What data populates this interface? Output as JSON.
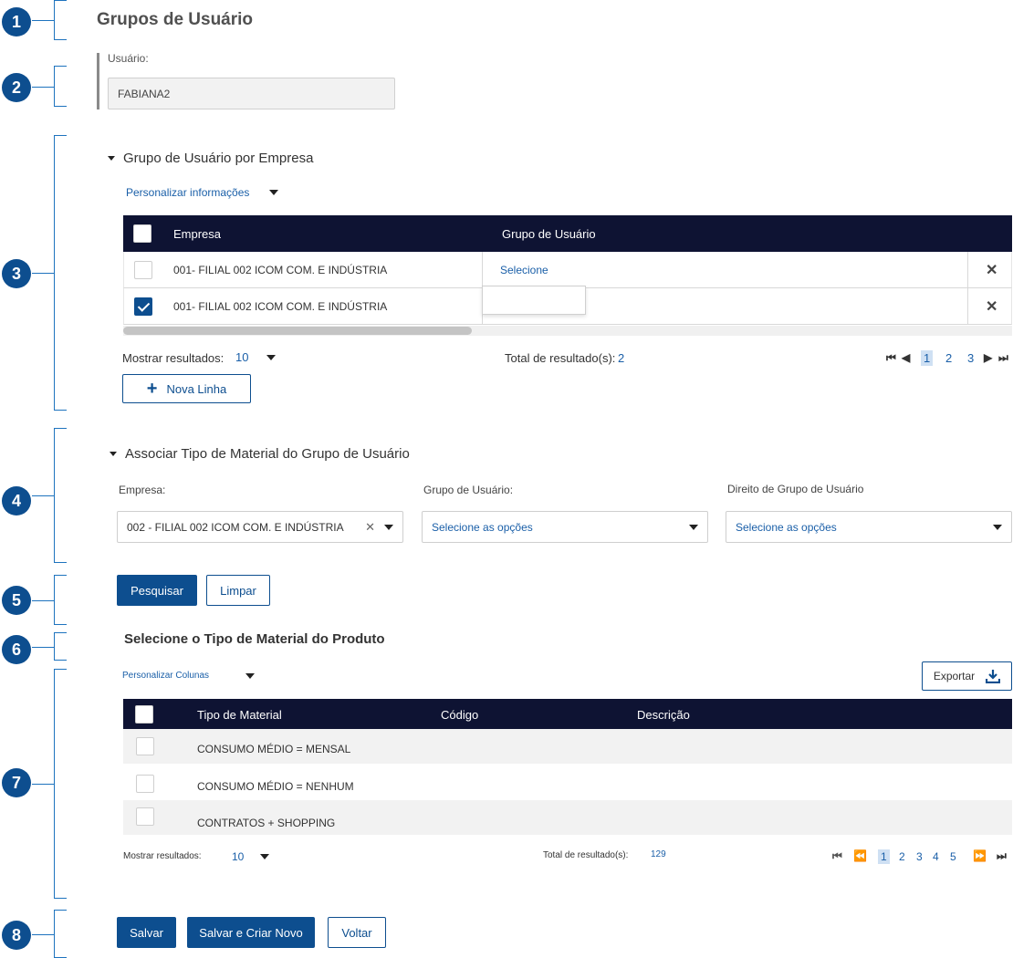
{
  "callouts": [
    "1",
    "2",
    "3",
    "4",
    "5",
    "6",
    "7",
    "8"
  ],
  "page_title": "Grupos de Usuário",
  "user": {
    "label": "Usuário:",
    "value": "FABIANA2"
  },
  "section1": {
    "title": "Grupo de Usuário por Empresa",
    "customize_label": "Personalizar informações",
    "columns": [
      "Empresa",
      "Grupo de Usuário"
    ],
    "rows": [
      {
        "checked": false,
        "empresa": "001- FILIAL 002 ICOM COM. E INDÚSTRIA",
        "grupo": "Selecione"
      },
      {
        "checked": true,
        "empresa": "001- FILIAL 002 ICOM COM. E INDÚSTRIA",
        "grupo": ""
      }
    ],
    "show_results_label": "Mostrar resultados:",
    "show_results_value": "10",
    "total_label": "Total de resultado(s):",
    "total_value": "2",
    "pages": [
      "1",
      "2",
      "3"
    ],
    "current_page": "1",
    "new_line_label": "Nova Linha"
  },
  "section2": {
    "title": "Associar Tipo de Material do Grupo de Usuário",
    "empresa_label": "Empresa:",
    "empresa_value": "002 - FILIAL 002 ICOM COM. E INDÚSTRIA",
    "grupo_label": "Grupo de Usuário:",
    "grupo_placeholder": "Selecione as opções",
    "direito_label": "Direito de Grupo de Usuário",
    "direito_placeholder": "Selecione as opções",
    "search_label": "Pesquisar",
    "clear_label": "Limpar"
  },
  "section3": {
    "title": "Selecione o Tipo de Material do Produto",
    "customize_label": "Personalizar Colunas",
    "export_label": "Exportar",
    "columns": [
      "Tipo de Material",
      "Código",
      "Descrição"
    ],
    "rows": [
      {
        "tipo": "CONSUMO MÉDIO = MENSAL",
        "codigo": "",
        "descricao": ""
      },
      {
        "tipo": "CONSUMO MÉDIO = NENHUM",
        "codigo": "",
        "descricao": ""
      },
      {
        "tipo": "CONTRATOS + SHOPPING",
        "codigo": "",
        "descricao": ""
      }
    ],
    "show_results_label": "Mostrar resultados:",
    "show_results_value": "10",
    "total_label": "Total de resultado(s):",
    "total_value": "129",
    "pages": [
      "1",
      "2",
      "3",
      "4",
      "5"
    ],
    "current_page": "1"
  },
  "footer": {
    "save_label": "Salvar",
    "save_new_label": "Salvar e Criar Novo",
    "back_label": "Voltar"
  },
  "colors": {
    "primary": "#0d4e8f",
    "header_dark": "#0e1333",
    "link": "#1a5fa8",
    "callout": "#0d4e8f"
  }
}
